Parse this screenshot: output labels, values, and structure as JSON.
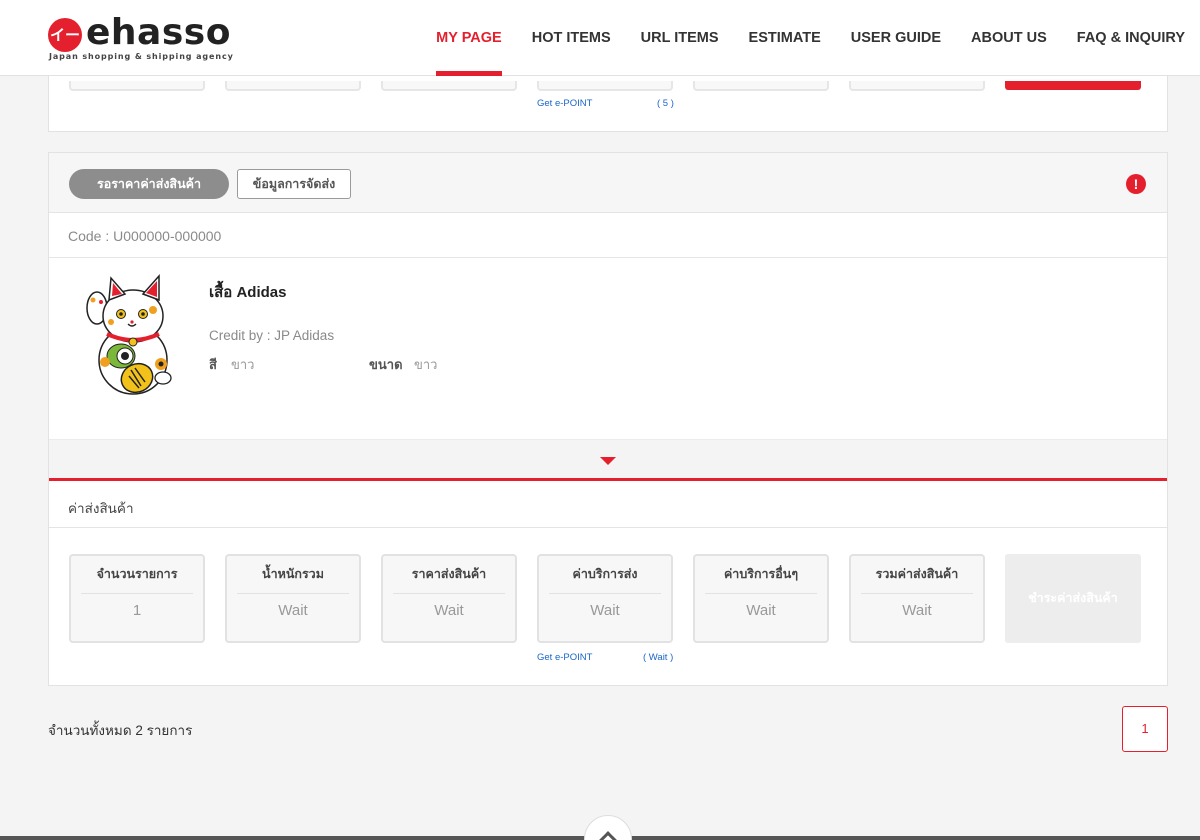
{
  "header": {
    "logo_mark": "イー",
    "logo_word": "ehasso",
    "logo_tagline": "Japan shopping & shipping agency",
    "nav": [
      {
        "label": "MY PAGE",
        "active": true
      },
      {
        "label": "HOT ITEMS",
        "active": false
      },
      {
        "label": "URL ITEMS",
        "active": false
      },
      {
        "label": "ESTIMATE",
        "active": false
      },
      {
        "label": "USER GUIDE",
        "active": false
      },
      {
        "label": "ABOUT US",
        "active": false
      },
      {
        "label": "FAQ & INQUIRY",
        "active": false
      }
    ]
  },
  "top_card": {
    "epoint_label": "Get e-POINT",
    "epoint_value": "( 5 )"
  },
  "order": {
    "status_pill": "รอราคาค่าส่งสินค้า",
    "shipping_info_button": "ข้อมูลการจัดส่ง",
    "alert_icon": "!",
    "code": "Code : U000000-000000",
    "product": {
      "name": "เสื้อ Adidas",
      "credit": "Credit by : JP Adidas",
      "color_label": "สี",
      "color_value": "ขาว",
      "size_label": "ขนาด",
      "size_value": "ขาว"
    },
    "section_title": "ค่าส่งสินค้า",
    "summary": [
      {
        "label": "จำนวนรายการ",
        "value": "1"
      },
      {
        "label": "น้ำหนักรวม",
        "value": "Wait"
      },
      {
        "label": "ราคาส่งสินค้า",
        "value": "Wait"
      },
      {
        "label": "ค่าบริการส่ง",
        "value": "Wait"
      },
      {
        "label": "ค่าบริการอื่นๆ",
        "value": "Wait"
      },
      {
        "label": "รวมค่าส่งสินค้า",
        "value": "Wait"
      }
    ],
    "pay_button": "ชำระค่าส่งสินค้า",
    "epoint_label": "Get e-POINT",
    "epoint_value": "( Wait )"
  },
  "footer": {
    "total_text": "จำนวนทั้งหมด 2 รายการ",
    "page": "1"
  },
  "colors": {
    "accent": "#e5202e",
    "link": "#1a66c8",
    "pill": "#8d8d8d"
  },
  "icons": [
    "alert-icon",
    "caret-down-icon",
    "chevron-up-icon",
    "maneki-neko-image"
  ]
}
